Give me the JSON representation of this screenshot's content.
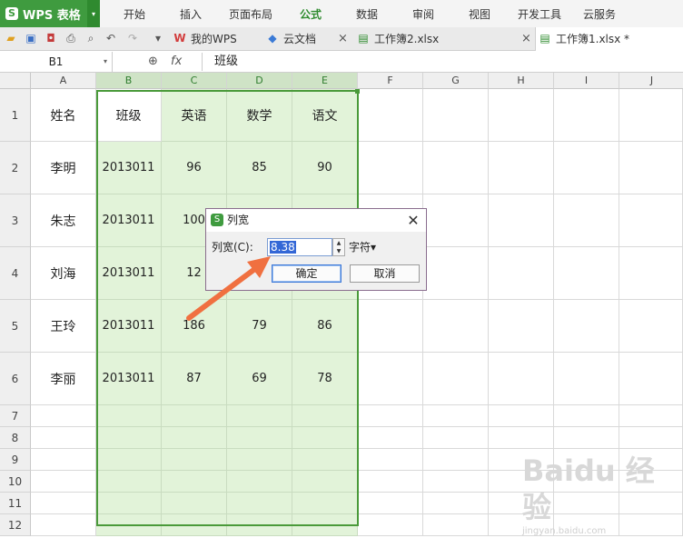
{
  "app": {
    "logo_text": "WPS 表格",
    "logo_icon": "S"
  },
  "menu": [
    {
      "label": "开始",
      "active": false
    },
    {
      "label": "插入",
      "active": false
    },
    {
      "label": "页面布局",
      "active": false
    },
    {
      "label": "公式",
      "active": true
    },
    {
      "label": "数据",
      "active": false
    },
    {
      "label": "审阅",
      "active": false
    },
    {
      "label": "视图",
      "active": false
    },
    {
      "label": "开发工具",
      "active": false
    },
    {
      "label": "云服务",
      "active": false
    }
  ],
  "toolbar_icons": [
    "open-folder-icon",
    "save-icon",
    "export-pdf-icon",
    "print-icon",
    "print-preview-icon",
    "undo-icon",
    "redo-icon",
    "dropdown-icon"
  ],
  "doc_tabs": [
    {
      "label": "我的WPS",
      "icon": "wps-w-icon"
    },
    {
      "label": "云文档",
      "icon": "cloud-box-icon"
    },
    {
      "label": "工作簿2.xlsx",
      "icon": "workbook-icon"
    },
    {
      "label": "工作簿1.xlsx *",
      "icon": "workbook-icon",
      "active": true
    }
  ],
  "formula_bar": {
    "cell_ref": "B1",
    "fx_label": "fx",
    "content": "班级"
  },
  "columns": [
    "A",
    "B",
    "C",
    "D",
    "E",
    "F",
    "G",
    "H",
    "I",
    "J"
  ],
  "selected_columns": [
    "B",
    "C",
    "D",
    "E"
  ],
  "rows": [
    "1",
    "2",
    "3",
    "4",
    "5",
    "6",
    "7",
    "8",
    "9",
    "10",
    "11",
    "12"
  ],
  "table": [
    [
      "姓名",
      "班级",
      "英语",
      "数学",
      "语文"
    ],
    [
      "李明",
      "2013011",
      "96",
      "85",
      "90"
    ],
    [
      "朱志",
      "2013011",
      "100",
      "",
      ""
    ],
    [
      "刘海",
      "2013011",
      "12",
      "",
      ""
    ],
    [
      "王玲",
      "2013011",
      "186",
      "79",
      "86"
    ],
    [
      "李丽",
      "2013011",
      "87",
      "69",
      "78"
    ]
  ],
  "dialog": {
    "title": "列宽",
    "label": "列宽(C):",
    "value": "8.38",
    "unit": "字符▾",
    "ok": "确定",
    "cancel": "取消"
  },
  "watermark": {
    "main": "Baidu 经验",
    "sub": "jingyan.baidu.com"
  },
  "colors": {
    "brand": "#3f9b3f",
    "selection": "#e2f3d9",
    "arrow": "#f07040"
  }
}
